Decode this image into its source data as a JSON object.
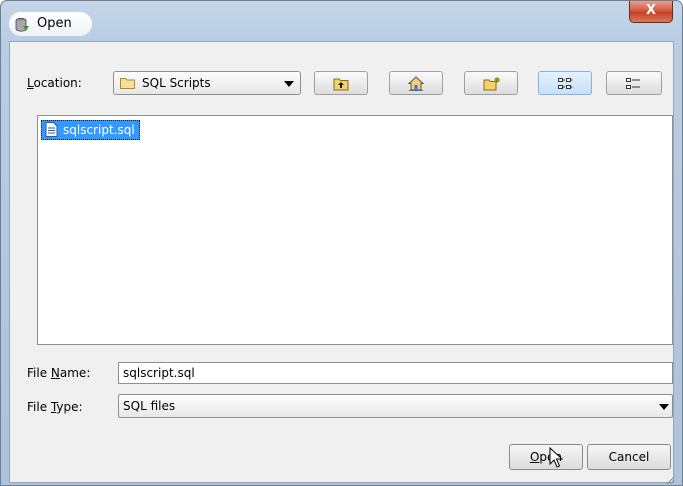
{
  "window": {
    "title": "Open",
    "close_glyph": "X"
  },
  "location": {
    "label_prefix": "",
    "label_mnemonic": "L",
    "label_rest": "ocation:",
    "value": "SQL Scripts"
  },
  "toolbar": {
    "buttons": [
      "up-one-level-icon",
      "home-icon",
      "new-folder-icon",
      "list-view-icon",
      "details-view-icon"
    ]
  },
  "files": [
    {
      "name": "sqlscript.sql",
      "selected": true
    }
  ],
  "file_name": {
    "label_prefix": "File ",
    "label_mnemonic": "N",
    "label_rest": "ame:",
    "value": "sqlscript.sql"
  },
  "file_type": {
    "label_prefix": "File ",
    "label_mnemonic": "T",
    "label_rest": "ype:",
    "value": "SQL files"
  },
  "actions": {
    "open_mnemonic": "O",
    "open_rest": "pen",
    "cancel_label": "Cancel"
  },
  "colors": {
    "selection": "#3399ff",
    "close_button": "#c7412a",
    "active_view": "#c7e0f7"
  }
}
